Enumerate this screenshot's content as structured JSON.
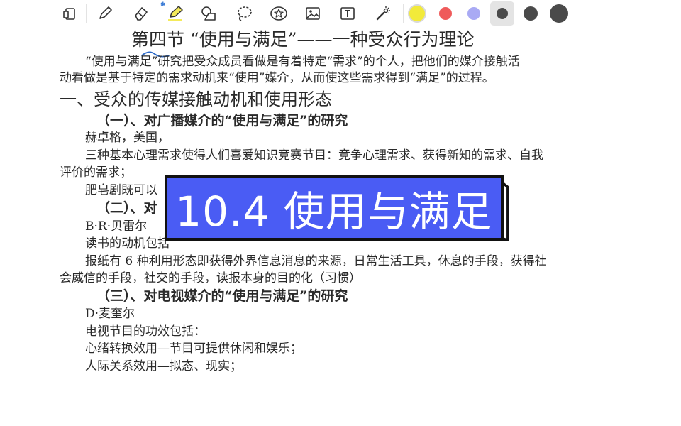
{
  "toolbar": {
    "tools": [
      "tablet-icon",
      "pen-icon",
      "eraser-icon",
      "highlighter-icon",
      "shapes-icon",
      "lasso-icon",
      "sticker-icon",
      "image-icon",
      "text-icon",
      "laser-pointer-icon"
    ],
    "colors": [
      "#f2ea3a",
      "#ef5a5a",
      "#a9aaf4",
      "#4a4a4a",
      "#4a4a4a",
      "#4a4a4a"
    ],
    "active_color_index": 3,
    "bluetooth_icon": "bluetooth-icon"
  },
  "doc": {
    "title": "第四节 “使用与满足”——一种受众行为理论",
    "intro_1": "“使用与满足”研究把受众成员看做是有着特定“需求”的个人，把他们的媒介接触活",
    "intro_2": "动看做是基于特定的需求动机来“使用”媒介，从而使这些需求得到“满足”的过程。",
    "section_1": "一、受众的传媒接触动机和使用形态",
    "sub_1": "（一）、对广播媒介的“使用与满足”的研究",
    "p_1": "赫卓格，美国，",
    "p_2a": "三种基本心理需求使得人们喜爱知识竞赛节目：竞争心理需求、获得新知的需求、自我",
    "p_2b": "评价的需求；",
    "p_3": "肥皂剧既可以",
    "sub_2": "（二）、对",
    "p_4": "B·R·贝雷尔",
    "p_5": "读书的动机包括",
    "p_6a": "报纸有 6 种利用形态即获得外界信息消息的来源，日常生活工具，休息的手段，获得社",
    "p_6b": "会威信的手段，社交的手段，读报本身的目的化（习惯）",
    "sub_3": "（三）、对电视媒介的“使用与满足”的研究",
    "p_7": "D·麦奎尔",
    "p_8": "电视节目的功效包括：",
    "p_9": "心绪转换效用—节目可提供休闲和娱乐；",
    "p_10": "人际关系效用—拟态、现实；"
  },
  "overlay": {
    "label": "10.4 使用与满足",
    "fill": "#4a5cf4",
    "border": "#111111"
  }
}
